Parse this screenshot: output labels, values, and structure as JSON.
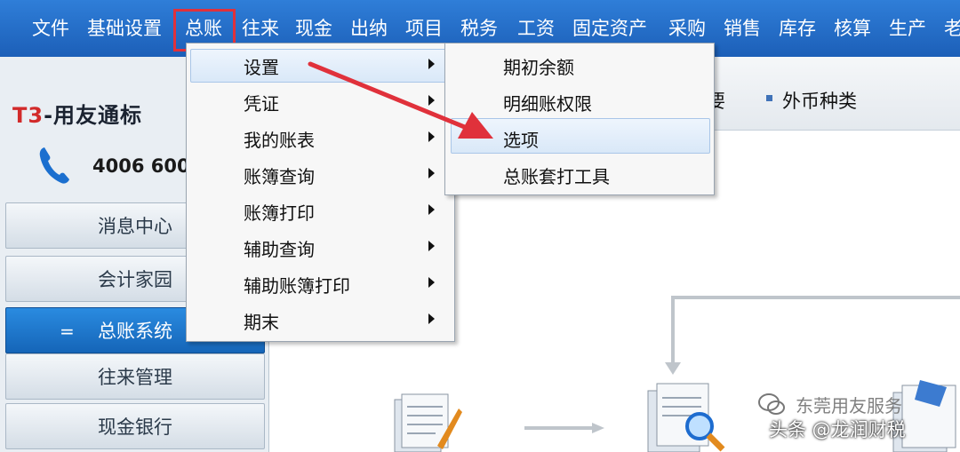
{
  "menubar": {
    "items": [
      "文件",
      "基础设置",
      "总账",
      "往来",
      "现金",
      "出纳",
      "项目",
      "税务",
      "工资",
      "固定资产",
      "采购",
      "销售",
      "库存",
      "核算",
      "生产",
      "老"
    ]
  },
  "sidebar": {
    "brand_prefix": "T3",
    "brand_rest": "-用友通标",
    "phone": "4006 600",
    "nav": [
      "消息中心",
      "会计家园",
      "总账系统",
      "往来管理",
      "现金银行"
    ],
    "active_marker": "="
  },
  "main": {
    "tab_partial": "要",
    "tab_currency": "外币种类"
  },
  "menu1": {
    "items": [
      "设置",
      "凭证",
      "我的账表",
      "账簿查询",
      "账簿打印",
      "辅助查询",
      "辅助账簿打印",
      "期末"
    ]
  },
  "menu2": {
    "items": [
      "期初余额",
      "明细账权限",
      "选项",
      "总账套打工具"
    ]
  },
  "watermark": {
    "line1": "东莞用友服务",
    "line2": "头条 @龙润财税"
  },
  "colors": {
    "menubar": "#1c5fb8",
    "highlight_box": "#e0313b",
    "annotation_arrow": "#e0313b",
    "active_nav": "#1565b8"
  }
}
